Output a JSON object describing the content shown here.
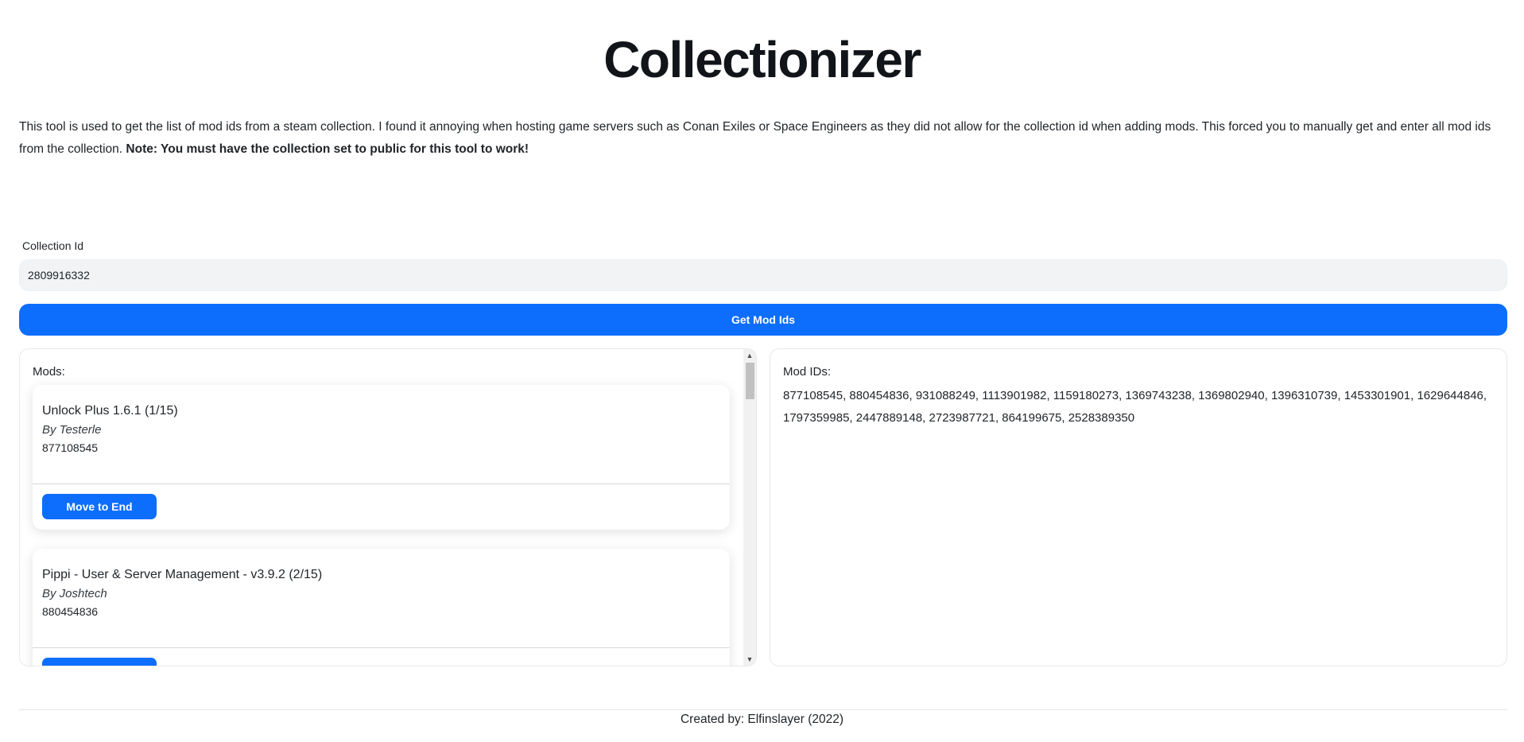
{
  "title": "Collectionizer",
  "intro": {
    "text": "This tool is used to get the list of mod ids from a steam collection. I found it annoying when hosting game servers such as Conan Exiles or Space Engineers as they did not allow for the collection id when adding mods. This forced you to manually get and enter all mod ids from the collection.",
    "note": "Note: You must have the collection set to public for this tool to work!"
  },
  "form": {
    "label": "Collection Id",
    "value": "2809916332",
    "button": "Get Mod Ids"
  },
  "mods": {
    "label": "Mods:",
    "items": [
      {
        "title": "Unlock Plus 1.6.1 (1/15)",
        "author": "By Testerle",
        "id": "877108545",
        "button": "Move to End"
      },
      {
        "title": "Pippi - User & Server Management - v3.9.2 (2/15)",
        "author": "By Joshtech",
        "id": "880454836",
        "button": "Move to End"
      }
    ]
  },
  "ids": {
    "label": "Mod IDs:",
    "text": "877108545, 880454836, 931088249, 1113901982, 1159180273, 1369743238, 1369802940, 1396310739, 1453301901, 1629644846, 1797359985, 2447889148, 2723987721, 864199675, 2528389350"
  },
  "footer": "Created by: Elfinslayer (2022)",
  "colors": {
    "primary": "#0d6efd",
    "input_bg": "#f1f3f5"
  }
}
